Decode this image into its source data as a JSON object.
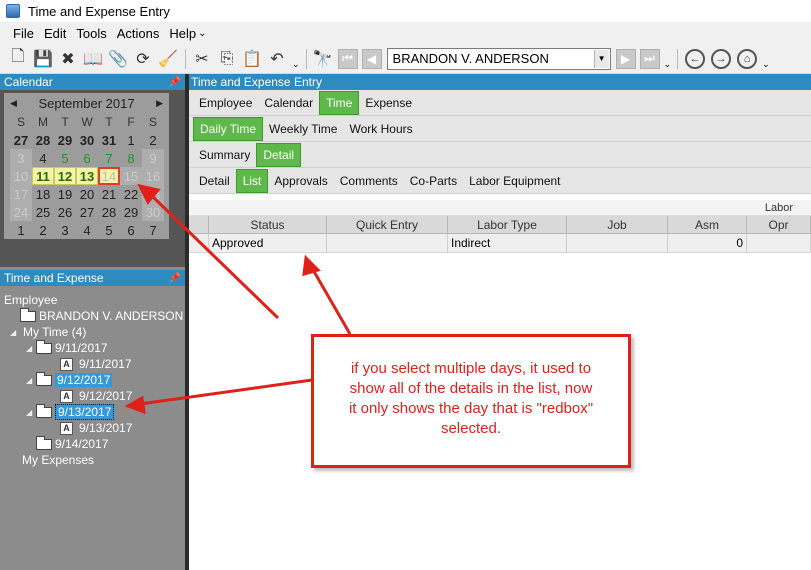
{
  "window": {
    "title": "Time and Expense Entry"
  },
  "menu": {
    "items": [
      "File",
      "Edit",
      "Tools",
      "Actions",
      "Help"
    ],
    "overflow_glyph": "⌄"
  },
  "toolbar": {
    "employee_value": "BRANDON V. ANDERSON",
    "icons": [
      "new-icon",
      "save-icon",
      "delete-icon",
      "book-icon",
      "attach-icon",
      "refresh-icon",
      "clear-icon",
      "cut-icon",
      "copy-icon",
      "paste-icon",
      "undo-icon",
      "search-icon",
      "first-icon",
      "prev-icon",
      "next-icon",
      "last-icon",
      "back-icon",
      "forward-icon",
      "home-icon"
    ]
  },
  "calendar_panel": {
    "title": "Calendar",
    "month_label": "September 2017",
    "days_of_week": [
      "S",
      "M",
      "T",
      "W",
      "T",
      "F",
      "S"
    ],
    "weeks": [
      [
        "27",
        "28",
        "29",
        "30",
        "31",
        "1",
        "2"
      ],
      [
        "3",
        "4",
        "5",
        "6",
        "7",
        "8",
        "9"
      ],
      [
        "10",
        "11",
        "12",
        "13",
        "14",
        "15",
        "16"
      ],
      [
        "17",
        "18",
        "19",
        "20",
        "21",
        "22",
        "23"
      ],
      [
        "24",
        "25",
        "26",
        "27",
        "28",
        "29",
        "30"
      ],
      [
        "1",
        "2",
        "3",
        "4",
        "5",
        "6",
        "7"
      ]
    ],
    "selected_days": [
      "11",
      "12",
      "13"
    ],
    "redbox_day": "14"
  },
  "time_expense_panel": {
    "title": "Time and Expense",
    "tree": {
      "root": "Employee",
      "employee": "BRANDON V. ANDERSON",
      "my_time": "My Time (4)",
      "entries": [
        {
          "date": "9/11/2017",
          "child": "9/11/2017"
        },
        {
          "date": "9/12/2017",
          "child": "9/12/2017"
        },
        {
          "date": "9/13/2017",
          "child": "9/13/2017"
        },
        {
          "date": "9/14/2017"
        }
      ],
      "my_expenses": "My Expenses",
      "child_badge": "A"
    }
  },
  "main": {
    "title": "Time and Expense Entry",
    "tabs_level1": [
      "Employee",
      "Calendar",
      "Time",
      "Expense"
    ],
    "tabs_level2": [
      "Daily Time",
      "Weekly Time",
      "Work Hours"
    ],
    "tabs_level3": [
      "Summary",
      "Detail"
    ],
    "tabs_level4": [
      "Detail",
      "List",
      "Approvals",
      "Comments",
      "Co-Parts",
      "Labor Equipment"
    ],
    "grid": {
      "group_label": "Labor",
      "columns": [
        "Status",
        "Quick Entry",
        "Labor Type",
        "Job",
        "Asm",
        "Opr"
      ],
      "rows": [
        {
          "status": "Approved",
          "quick_entry": "",
          "labor_type": "Indirect",
          "job": "",
          "asm": "0",
          "opr": ""
        }
      ]
    }
  },
  "annotation": {
    "line1": "if you select multiple days, it used to",
    "line2": "show all of the details in the list, now",
    "line3": "it only shows the day that is \"redbox\"",
    "line4": "selected.",
    "color": "#e0201b"
  }
}
